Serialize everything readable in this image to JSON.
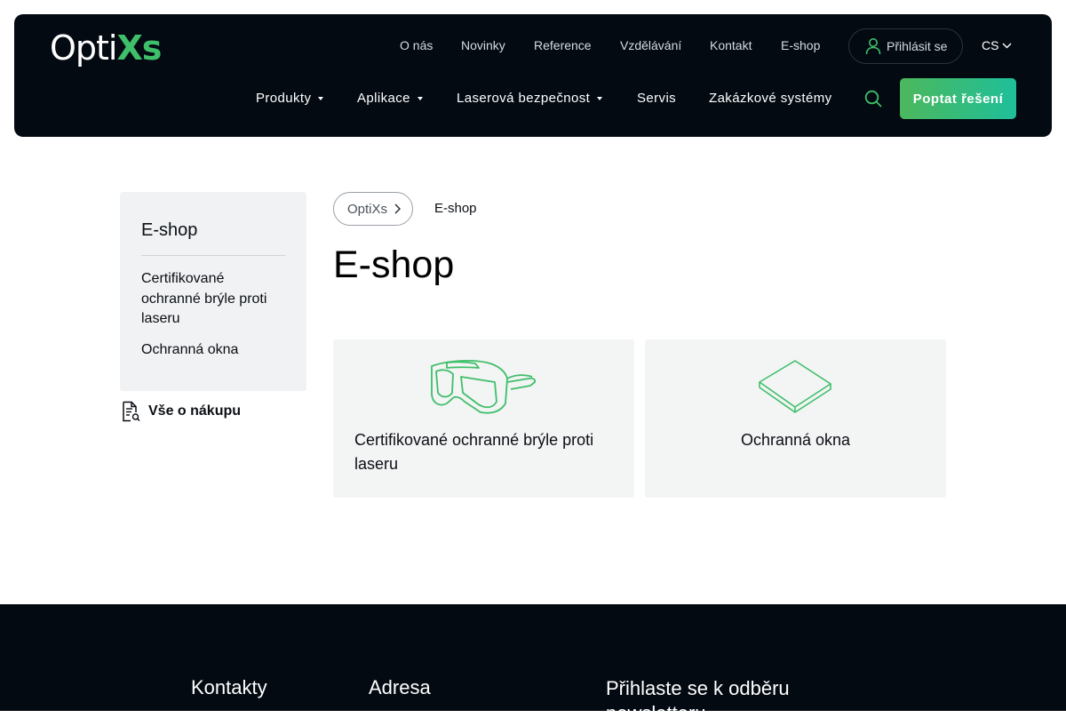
{
  "header": {
    "logo_prefix": "Opti",
    "logo_accent": "Xs",
    "top_links": [
      "O nás",
      "Novinky",
      "Reference",
      "Vzdělávání",
      "Kontakt",
      "E-shop"
    ],
    "login_label": "Přihlásit se",
    "language": "CS",
    "main_nav": [
      "Produkty",
      "Aplikace",
      "Laserová bezpečnost",
      "Servis",
      "Zakázkové systémy"
    ],
    "cta_label": "Poptat řešení"
  },
  "sidebar": {
    "title": "E-shop",
    "items": [
      "Certifikované ochranné brýle proti laseru",
      "Ochranná okna"
    ],
    "info_link": "Vše o nákupu"
  },
  "breadcrumb": {
    "home": "OptiXs",
    "current": "E-shop"
  },
  "page_title": "E-shop",
  "cards": [
    {
      "label": "Certifikované ochranné brýle proti laseru",
      "icon": "laser-goggles-icon"
    },
    {
      "label": "Ochranná okna",
      "icon": "protective-window-icon"
    }
  ],
  "footer": {
    "col1": "Kontakty",
    "col2": "Adresa",
    "col3": "Přihlaste se k odběru newsletteru"
  },
  "colors": {
    "header_bg": "#040a12",
    "accent_green": "#3fbf6a",
    "cta_gradient_start": "#4cb85c",
    "cta_gradient_end": "#1fbf9a",
    "card_bg": "#f3f4f4",
    "sidebar_bg": "#f0f2f3"
  }
}
